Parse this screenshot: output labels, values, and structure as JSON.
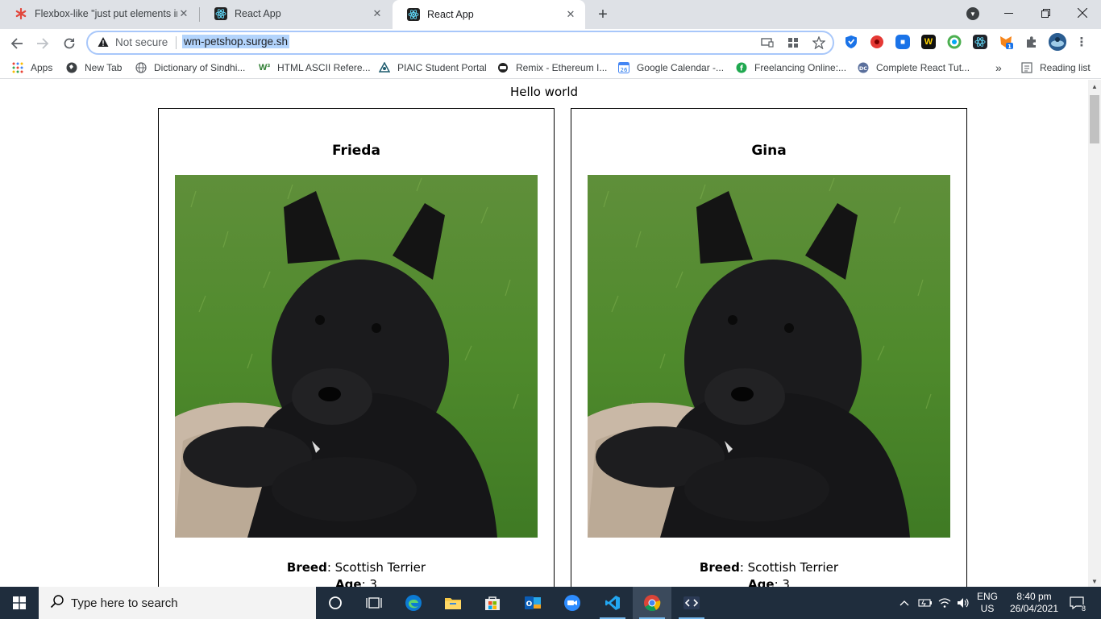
{
  "tabs": [
    {
      "title": "Flexbox-like \"just put elements in",
      "active": false
    },
    {
      "title": "React App",
      "active": false
    },
    {
      "title": "React App",
      "active": true
    }
  ],
  "omnibox": {
    "security_label": "Not secure",
    "url": "wm-petshop.surge.sh"
  },
  "bookmarks": [
    {
      "label": "Apps",
      "icon": "apps-grid-icon"
    },
    {
      "label": "New Tab",
      "icon": "globe-icon"
    },
    {
      "label": "Dictionary of Sindhi...",
      "icon": "globe-icon"
    },
    {
      "label": "HTML ASCII Refere...",
      "icon": "w3-icon"
    },
    {
      "label": "PIAIC Student Portal",
      "icon": "piaic-icon"
    },
    {
      "label": "Remix - Ethereum I...",
      "icon": "remix-icon"
    },
    {
      "label": "Google Calendar -...",
      "icon": "calendar-icon"
    },
    {
      "label": "Freelancing Online:...",
      "icon": "freelancing-icon"
    },
    {
      "label": "Complete React Tut...",
      "icon": "dc-icon"
    }
  ],
  "bookmarks_overflow": "»",
  "reading_list": "Reading list",
  "page": {
    "heading": "Hello world",
    "pets": [
      {
        "name": "Frieda",
        "breed_label": "Breed",
        "breed": "Scottish Terrier",
        "age_label": "Age",
        "age": "3"
      },
      {
        "name": "Gina",
        "breed_label": "Breed",
        "breed": "Scottish Terrier",
        "age_label": "Age",
        "age": "3"
      }
    ]
  },
  "taskbar": {
    "search_placeholder": "Type here to search",
    "language": "ENG",
    "region": "US",
    "time": "8:40 pm",
    "date": "26/04/2021",
    "notifications": "8"
  },
  "colors": {
    "tabstrip": "#dee1e6",
    "taskbar": "#1f2d3d",
    "url_highlight": "#b3d4fc"
  }
}
